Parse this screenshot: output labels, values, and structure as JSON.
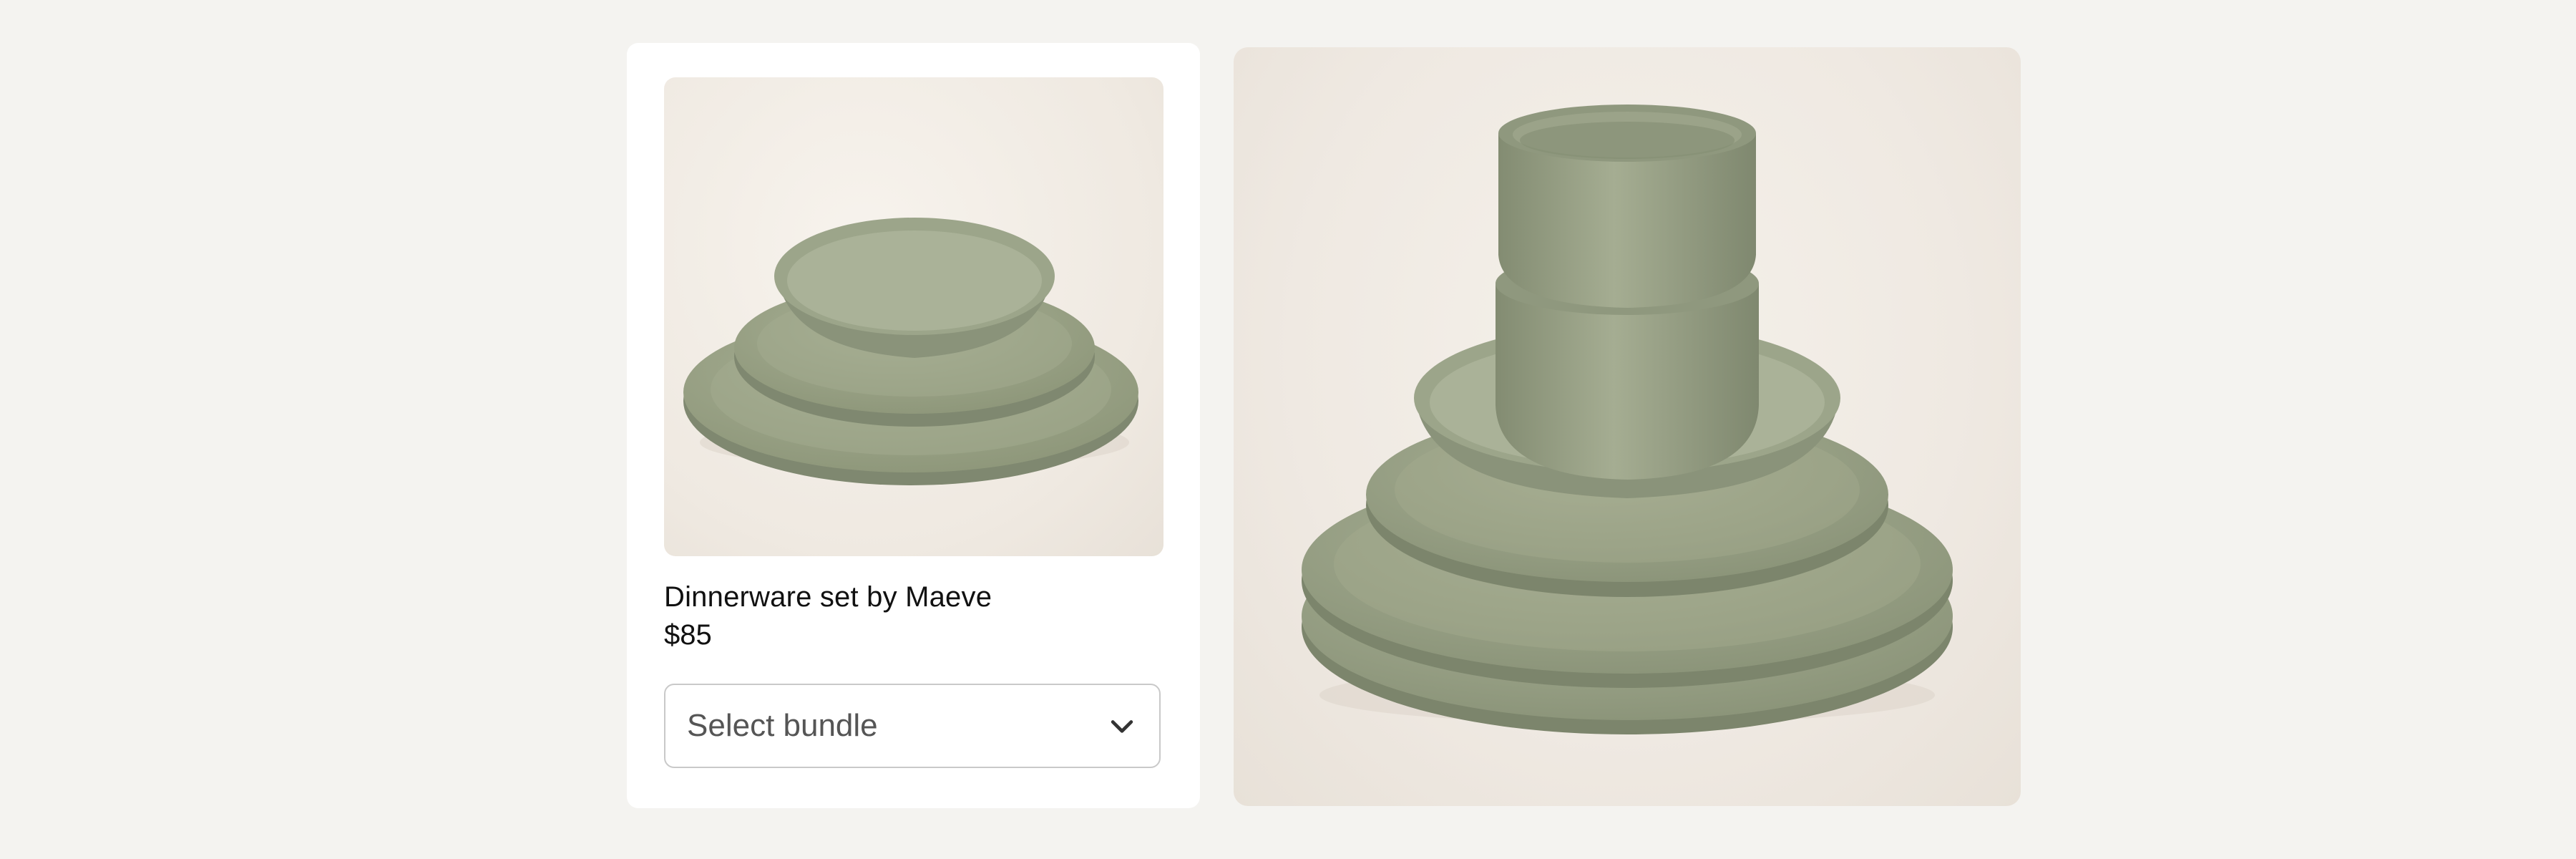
{
  "product": {
    "title": "Dinnerware set by Maeve",
    "price": "$85",
    "thumbnail_alt": "Dinnerware set thumbnail",
    "hero_alt": "Dinnerware set stacked with cups"
  },
  "bundle_select": {
    "label": "Select bundle",
    "icon": "chevron-down-icon"
  },
  "colors": {
    "page_bg": "#f4f3f0",
    "card_bg": "#ffffff",
    "ceramic": "#9aa386",
    "ceramic_dark": "#7f8870",
    "ceramic_light": "#a7af93"
  }
}
